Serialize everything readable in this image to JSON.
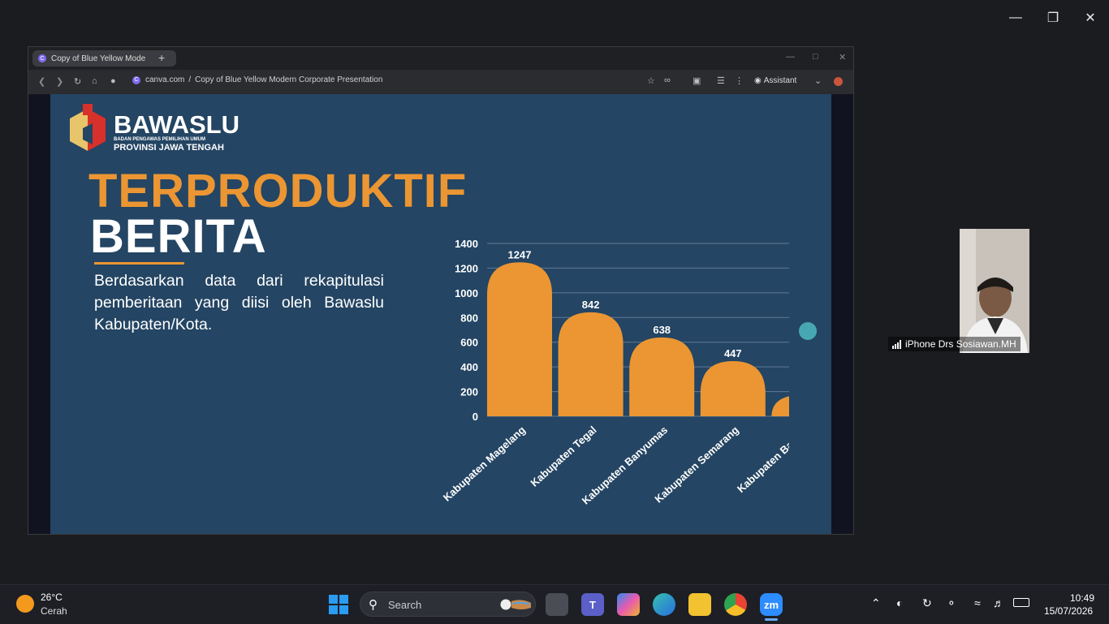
{
  "browser": {
    "tab_title": "Copy of Blue Yellow Mode",
    "new_tab": "+",
    "url_domain": "canva.com",
    "url_sep": "/",
    "url_path": "Copy of Blue Yellow Modern Corporate Presentation",
    "assistant_label": "Assistant"
  },
  "slide": {
    "logo_title": "BAWASLU",
    "logo_sub1": "BADAN PENGAWAS PEMILIHAN UMUM",
    "logo_sub2": "PROVINSI JAWA TENGAH",
    "title_line1": "TERPRODUKTIF",
    "title_line2": "BERITA",
    "body": "Berdasarkan data dari rekapitulasi pemberitaan yang diisi oleh Bawaslu Kabupaten/Kota.",
    "colors": {
      "background": "#244563",
      "accent": "#eb9633",
      "bar": "#eb9633",
      "dot": "#47a8b3"
    }
  },
  "chart_data": {
    "type": "bar",
    "categories": [
      "Kabupaten Magelang",
      "Kabupaten Tegal",
      "Kabupaten Banyumas",
      "Kabupaten Semarang",
      "Kabupaten Batang"
    ],
    "values": [
      1247,
      842,
      638,
      447,
      175
    ],
    "yticks": [
      0,
      200,
      400,
      600,
      800,
      1000,
      1200,
      1400
    ],
    "ylim": [
      0,
      1400
    ],
    "grid": true,
    "title": "",
    "xlabel": "",
    "ylabel": ""
  },
  "participant": {
    "name": "iPhone Drs Sosiawan.MH"
  },
  "taskbar": {
    "weather_temp": "26°C",
    "weather_desc": "Cerah",
    "search_label": "Search",
    "zoom_label": "zm",
    "time": "10:49",
    "date": "15/07/2026"
  }
}
